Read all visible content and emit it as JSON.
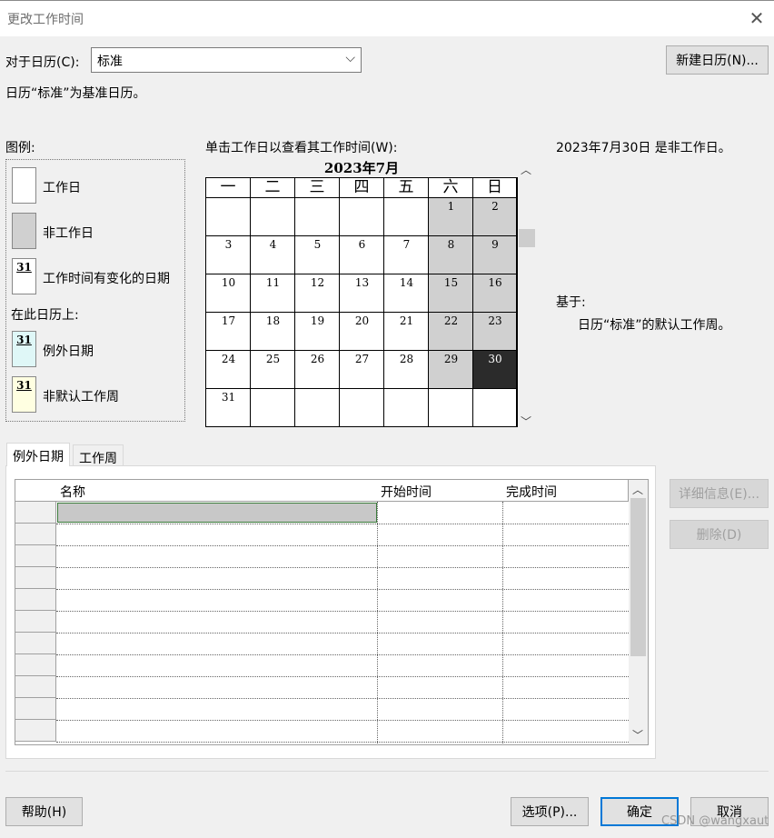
{
  "window": {
    "title": "更改工作时间",
    "close_symbol": "✕"
  },
  "calendar_picker": {
    "label": "对于日历(C):",
    "selected": "标准",
    "new_calendar_button": "新建日历(N)..."
  },
  "info_text": "日历“标准”为基准日历。",
  "legend": {
    "title": "图例:",
    "items": [
      {
        "label": "工作日"
      },
      {
        "label": "非工作日"
      },
      {
        "label": "工作时间有变化的日期",
        "number": "31"
      }
    ],
    "on_this_calendar": "在此日历上:",
    "calendar_items": [
      {
        "label": "例外日期",
        "number": "31"
      },
      {
        "label": "非默认工作周",
        "number": "31"
      }
    ],
    "colors": {
      "working": "#ffffff",
      "nonworking": "#d0d0d0",
      "exception": "#dff7f7",
      "nondefault_week": "#ffffe1"
    }
  },
  "calendar": {
    "instruction": "单击工作日以查看其工作时间(W):",
    "month_title": "2023年7月",
    "weekdays": [
      "一",
      "二",
      "三",
      "四",
      "五",
      "六",
      "日"
    ],
    "weeks": [
      [
        "",
        "",
        "",
        "",
        "",
        "1",
        "2"
      ],
      [
        "3",
        "4",
        "5",
        "6",
        "7",
        "8",
        "9"
      ],
      [
        "10",
        "11",
        "12",
        "13",
        "14",
        "15",
        "16"
      ],
      [
        "17",
        "18",
        "19",
        "20",
        "21",
        "22",
        "23"
      ],
      [
        "24",
        "25",
        "26",
        "27",
        "28",
        "29",
        "30"
      ],
      [
        "31",
        "",
        "",
        "",
        "",
        "",
        ""
      ]
    ],
    "selected_day": "30"
  },
  "selected_info": {
    "date_status": "2023年7月30日 是非工作日。",
    "based_on_label": "基于:",
    "based_on_value": "日历“标准”的默认工作周。"
  },
  "tabs": [
    {
      "label": "例外日期",
      "active": true
    },
    {
      "label": "工作周",
      "active": false
    }
  ],
  "exceptions_table": {
    "columns": [
      "名称",
      "开始时间",
      "完成时间"
    ],
    "row_count": 11
  },
  "side_buttons": {
    "details": "详细信息(E)...",
    "delete": "删除(D)"
  },
  "footer": {
    "help": "帮助(H)",
    "options": "选项(P)...",
    "ok": "确定",
    "cancel": "取消"
  },
  "watermark": "CSDN @wangxaut"
}
